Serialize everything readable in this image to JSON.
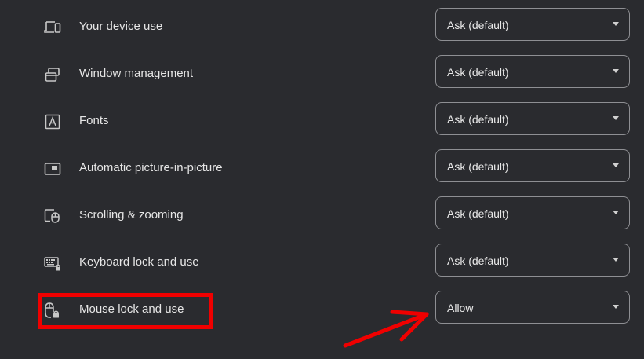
{
  "rows": [
    {
      "label": "Your device use",
      "value": "Ask (default)",
      "icon": "device-use-icon"
    },
    {
      "label": "Window management",
      "value": "Ask (default)",
      "icon": "window-management-icon"
    },
    {
      "label": "Fonts",
      "value": "Ask (default)",
      "icon": "fonts-icon"
    },
    {
      "label": "Automatic picture-in-picture",
      "value": "Ask (default)",
      "icon": "picture-in-picture-icon"
    },
    {
      "label": "Scrolling & zooming",
      "value": "Ask (default)",
      "icon": "scrolling-zooming-icon"
    },
    {
      "label": "Keyboard lock and use",
      "value": "Ask (default)",
      "icon": "keyboard-lock-icon"
    },
    {
      "label": "Mouse lock and use",
      "value": "Allow",
      "icon": "mouse-lock-icon"
    }
  ],
  "annotations": {
    "highlight_color": "#f00000",
    "arrow_color": "#f00000"
  },
  "colors": {
    "background": "#2a2b2f",
    "select_border": "#8e8f93",
    "text": "#e3e3e3"
  }
}
